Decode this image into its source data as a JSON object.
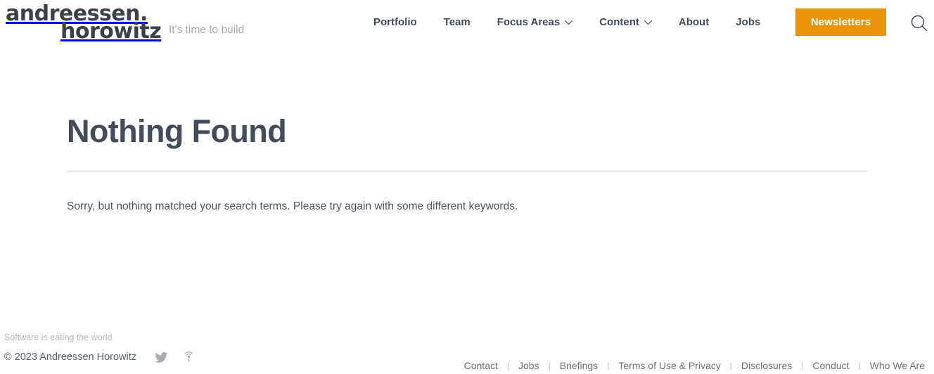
{
  "header": {
    "logo": {
      "line1": "andreessen.",
      "line2": "horowitz",
      "icon_name": "a16z-logo"
    },
    "tagline": "It's time to build",
    "nav": [
      {
        "label": "Portfolio",
        "has_dropdown": false
      },
      {
        "label": "Team",
        "has_dropdown": false
      },
      {
        "label": "Focus Areas",
        "has_dropdown": true
      },
      {
        "label": "Content",
        "has_dropdown": true
      },
      {
        "label": "About",
        "has_dropdown": false
      },
      {
        "label": "Jobs",
        "has_dropdown": false
      }
    ],
    "newsletters_button": "Newsletters",
    "search_icon": "search-icon"
  },
  "main": {
    "title": "Nothing Found",
    "body": "Sorry, but nothing matched your search terms. Please try again with some different keywords."
  },
  "footer": {
    "motto": "Software is eating the world",
    "copyright": "© 2023 Andreessen Horowitz",
    "social": [
      {
        "name": "twitter-icon"
      },
      {
        "name": "podcast-icon"
      }
    ],
    "links": [
      "Contact",
      "Jobs",
      "Briefings",
      "Terms of Use & Privacy",
      "Disclosures",
      "Conduct",
      "Who We Are"
    ],
    "separator": "|"
  },
  "colors": {
    "accent_orange": "#e8940c",
    "text_dark": "#444c58",
    "text_muted": "#6c7077",
    "divider": "#d8dadd"
  }
}
